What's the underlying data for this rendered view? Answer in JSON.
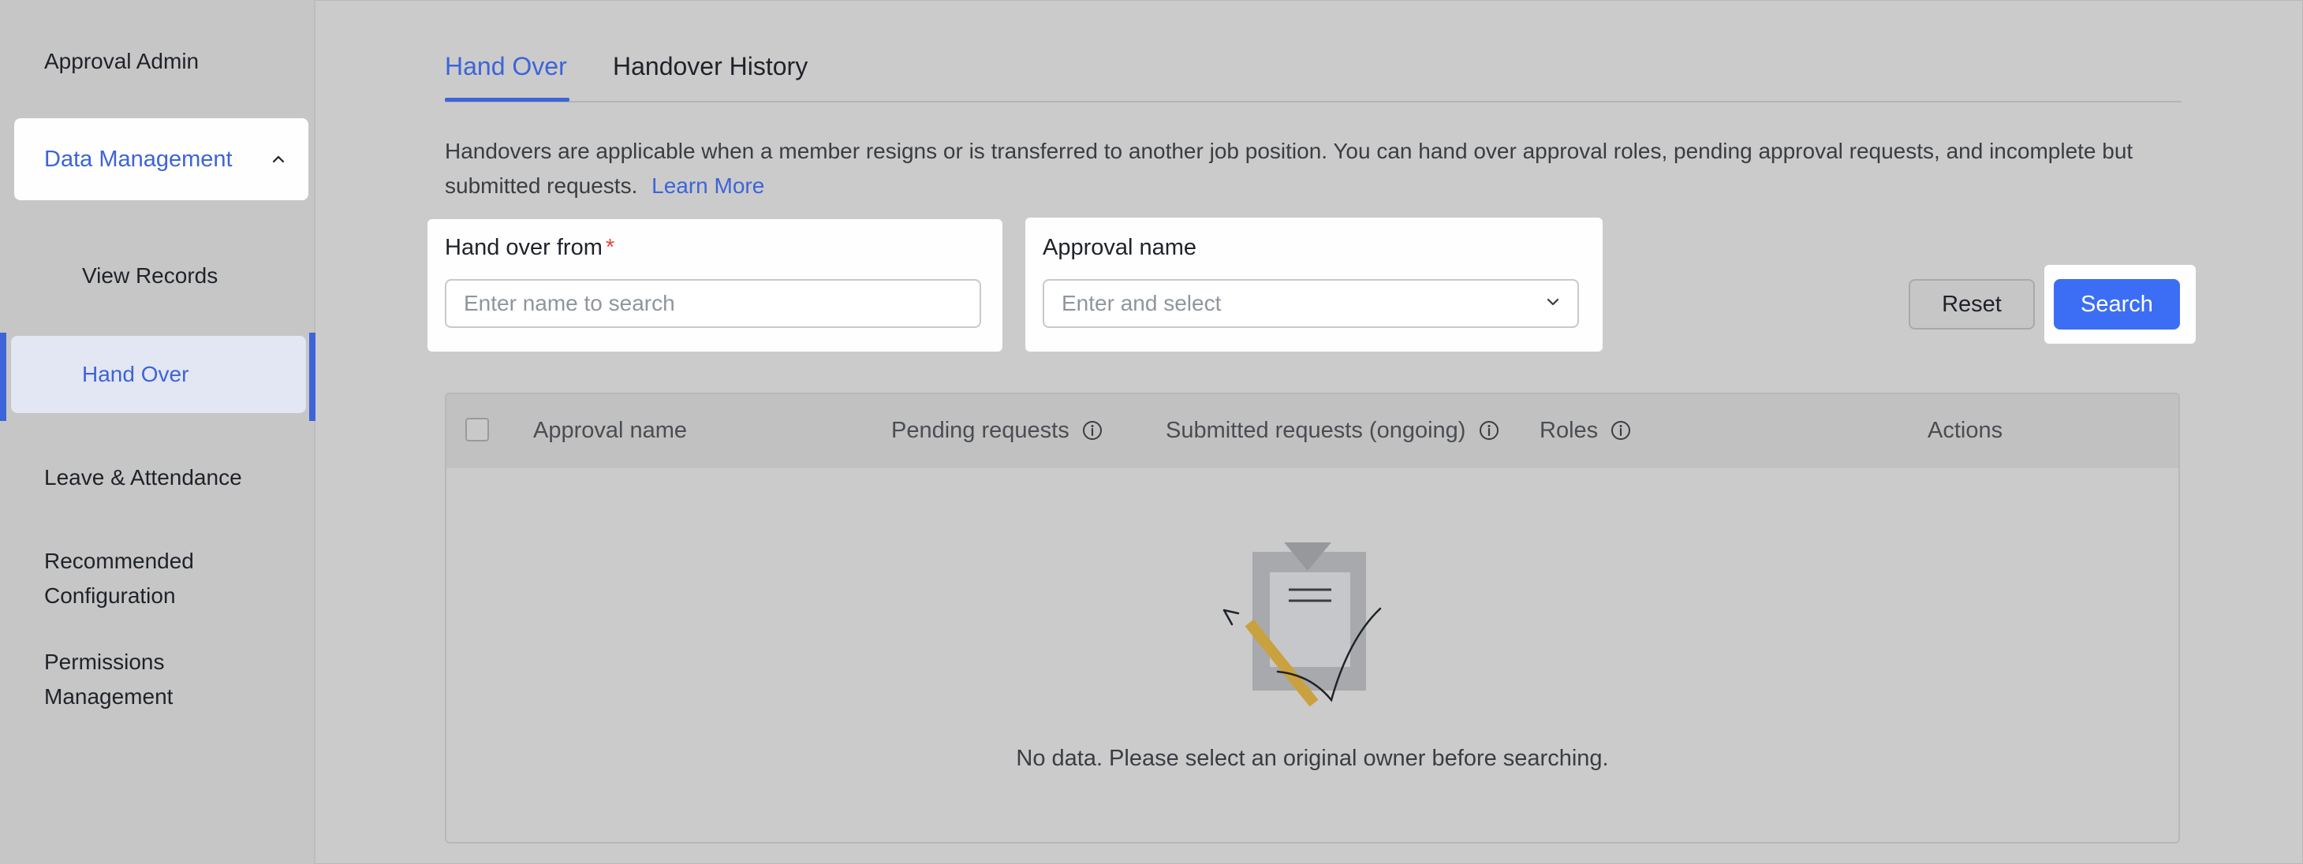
{
  "sidebar": {
    "approval_admin": "Approval Admin",
    "data_management": "Data Management",
    "view_records": "View Records",
    "hand_over": "Hand Over",
    "leave_attendance": "Leave & Attendance",
    "recommended_configuration_line1": "Recommended",
    "recommended_configuration_line2": "Configuration",
    "permissions_management_line1": "Permissions",
    "permissions_management_line2": "Management"
  },
  "tabs": {
    "hand_over": "Hand Over",
    "handover_history": "Handover History"
  },
  "description": {
    "text": "Handovers are applicable when a member resigns or is transferred to another job position. You can hand over approval roles, pending approval requests, and incomplete but submitted requests.",
    "learn_more": "Learn More"
  },
  "filters": {
    "hand_over_from": {
      "label": "Hand over from",
      "required_mark": "*",
      "placeholder": "Enter name to search",
      "value": ""
    },
    "approval_name": {
      "label": "Approval name",
      "placeholder": "Enter and select",
      "value": ""
    },
    "reset_label": "Reset",
    "search_label": "Search"
  },
  "table": {
    "columns": {
      "approval_name": "Approval name",
      "pending_requests": "Pending requests",
      "submitted_requests": "Submitted requests (ongoing)",
      "roles": "Roles",
      "actions": "Actions"
    },
    "empty_text": "No data. Please select an original owner before searching."
  },
  "colors": {
    "accent": "#3d64d8",
    "primary_button": "#3c6ef5",
    "required": "#e5453a"
  },
  "icons": {
    "collapse": "chevron-up-icon",
    "dropdown": "chevron-down-icon",
    "info": "info-circle-icon",
    "empty_state": "clipboard-pencil-illustration"
  }
}
